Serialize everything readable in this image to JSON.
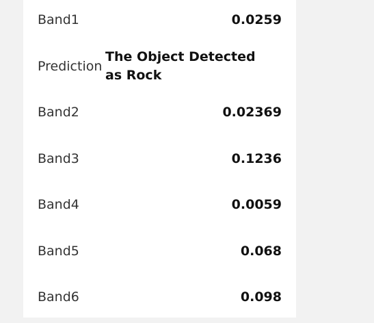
{
  "rows": [
    {
      "label": "Band1",
      "value": "0.0259"
    },
    {
      "label": "Prediction",
      "value": "The Object Detected as Rock"
    },
    {
      "label": "Band2",
      "value": "0.02369"
    },
    {
      "label": "Band3",
      "value": "0.1236"
    },
    {
      "label": "Band4",
      "value": "0.0059"
    },
    {
      "label": "Band5",
      "value": "0.068"
    },
    {
      "label": "Band6",
      "value": "0.098"
    }
  ]
}
